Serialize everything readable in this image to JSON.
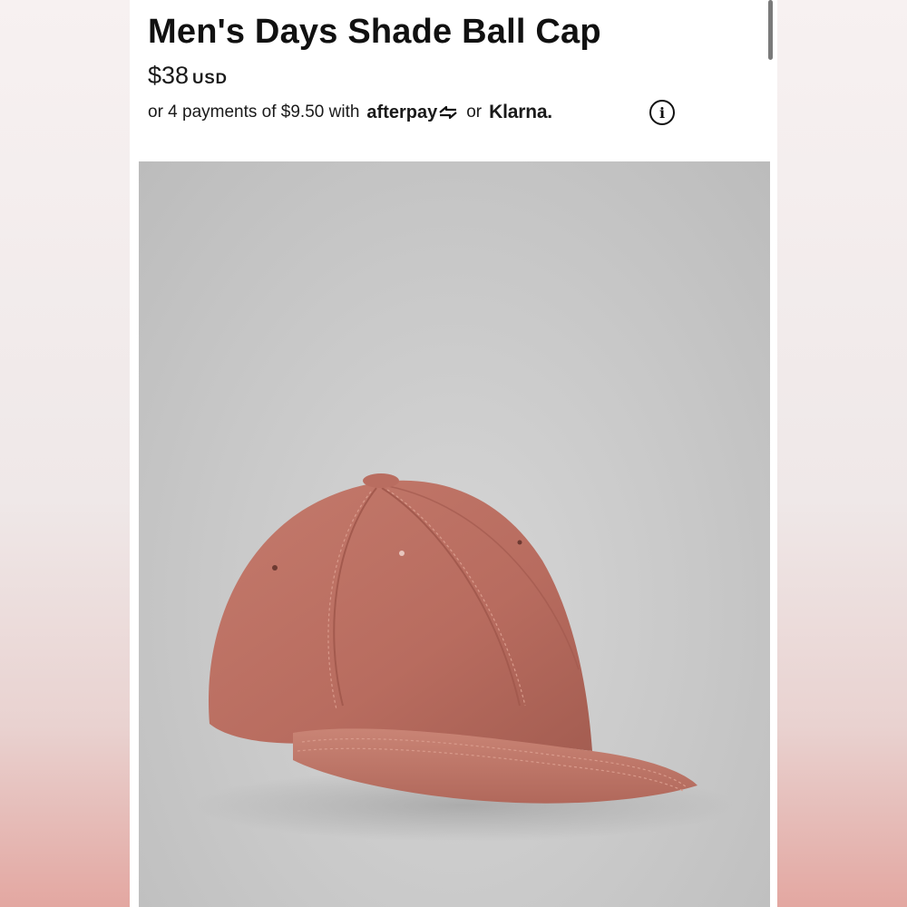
{
  "product": {
    "title": "Men's Days Shade Ball Cap",
    "price": "$38",
    "currency": "USD"
  },
  "payment": {
    "prefix": "or 4 payments of $9.50 with",
    "afterpay": "afterpay",
    "or": "or",
    "klarna": "Klarna."
  },
  "icons": {
    "info": "info-icon",
    "afterpay_arrows": "afterpay-arrows-icon"
  },
  "colors": {
    "cap": "#c07567",
    "image_bg": "#c8c8c8",
    "text": "#111111"
  }
}
